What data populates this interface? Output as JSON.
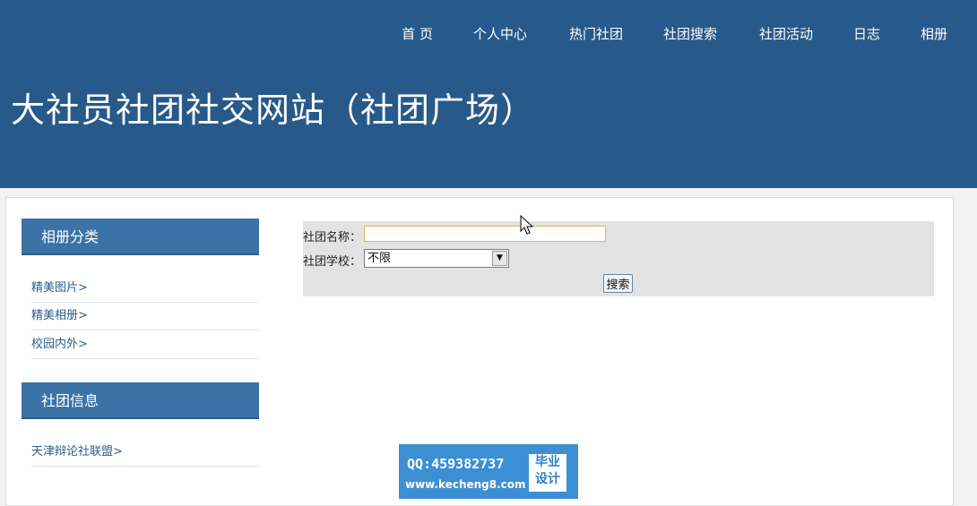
{
  "nav": {
    "items": [
      "首 页",
      "个人中心",
      "热门社团",
      "社团搜索",
      "社团活动",
      "日志",
      "相册"
    ]
  },
  "header": {
    "title": "大社员社团社交网站（社团广场）"
  },
  "sidebar": {
    "album_section": {
      "title": "相册分类",
      "links": [
        "精美图片>",
        "精美相册>",
        "校园内外>"
      ]
    },
    "club_section": {
      "title": "社团信息",
      "links": [
        "天津辩论社联盟>"
      ]
    }
  },
  "search": {
    "name_label": "社团名称：",
    "name_value": "",
    "school_label": "社团学校：",
    "school_selected": "不限",
    "button_label": "搜索"
  },
  "watermark": {
    "qq": "QQ:459382737",
    "site": "www.kecheng8.com",
    "badge_line1": "毕业",
    "badge_line2": "设计"
  },
  "colors": {
    "header_bg": "#275a8a",
    "sidebar_header_bg": "#3b73a6",
    "link": "#2a5d8f",
    "search_panel_bg": "#e3e3e3",
    "watermark_bg": "#3d8fd4"
  }
}
